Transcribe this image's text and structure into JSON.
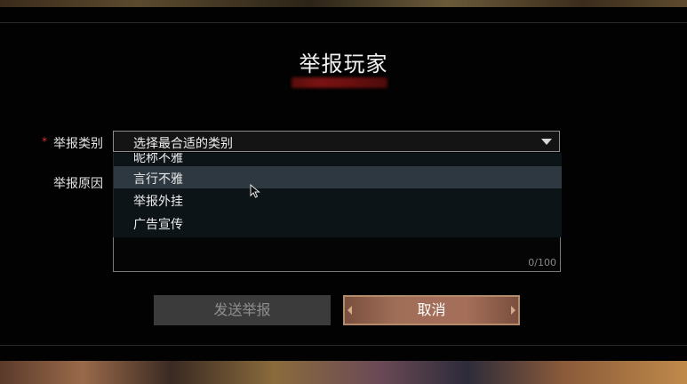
{
  "dialog": {
    "title": "举报玩家"
  },
  "form": {
    "category_label": "举报类别",
    "required_mark": "*",
    "reason_label": "举报原因",
    "category_select_value": "选择最合适的类别",
    "dropdown_options": [
      "昵称不雅",
      "言行不雅",
      "举报外挂",
      "广告宣传"
    ],
    "highlighted_option": "言行不雅",
    "reason_counter": "0/100"
  },
  "buttons": {
    "send_label": "发送举报",
    "cancel_label": "取消"
  },
  "colors": {
    "required_star": "#dd3333",
    "cancel_button": "#a06e58",
    "send_button_disabled": "#3b3b3c",
    "dropdown_highlight": "#2d3840"
  }
}
